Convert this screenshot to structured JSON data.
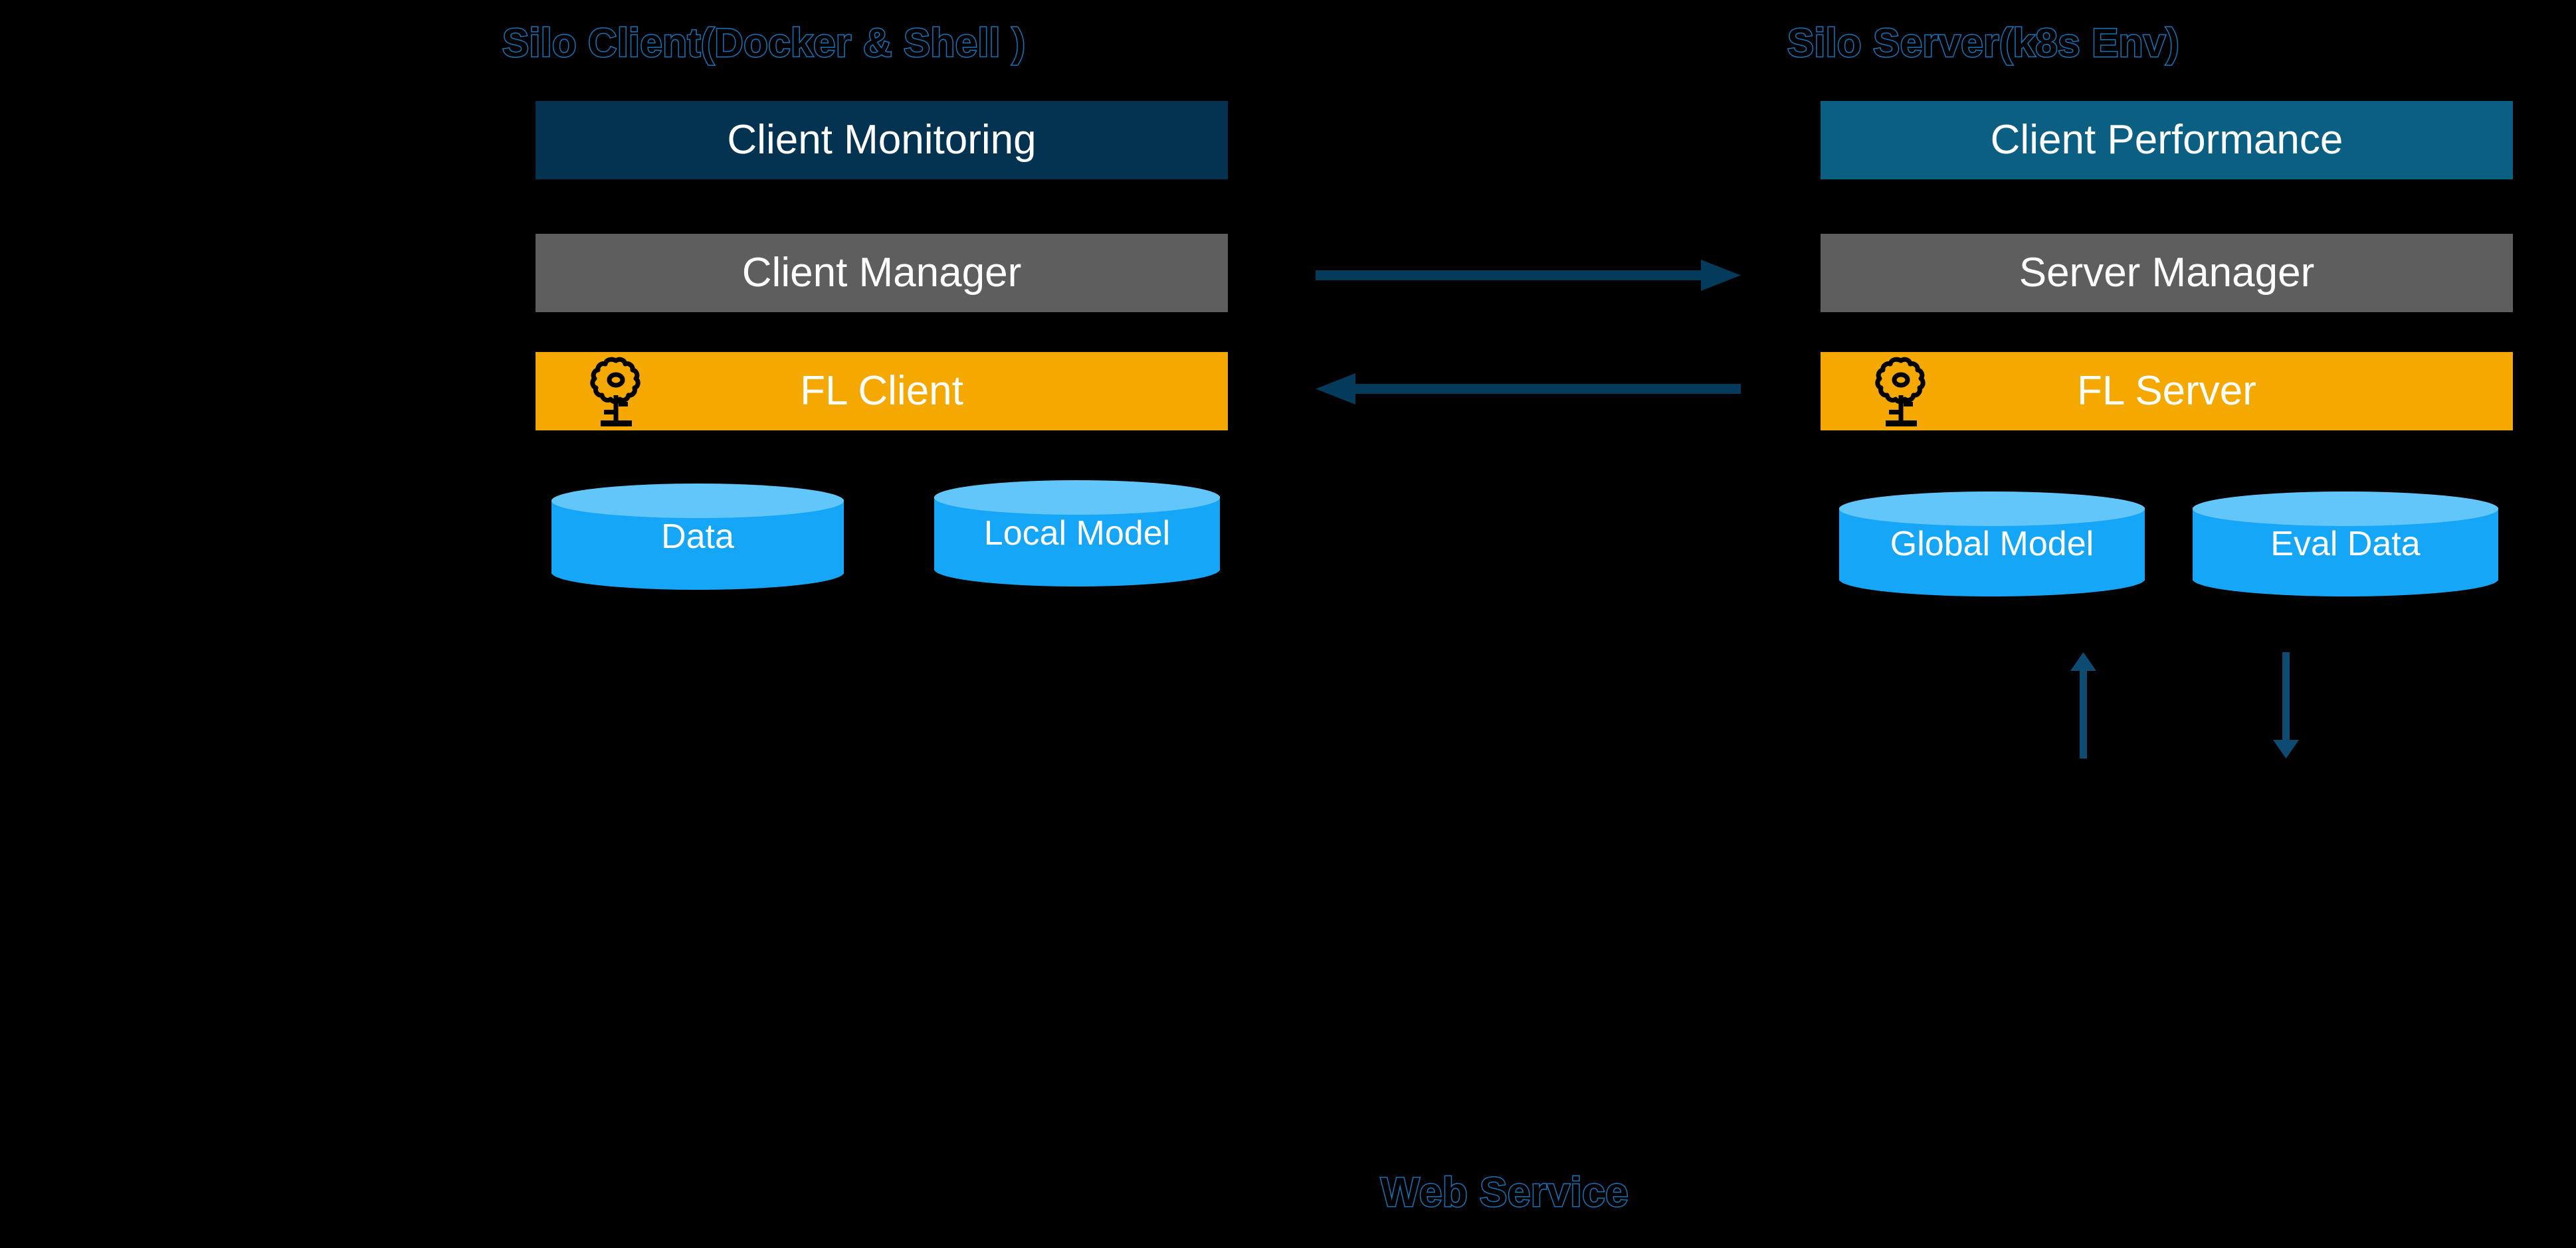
{
  "diagram": {
    "background_color": "#000000",
    "headings": [
      {
        "id": "client-col-title",
        "text": "Silo Client(Docker & Shell )"
      },
      {
        "id": "server-col-title",
        "text": "Silo Server(k8s Env)"
      },
      {
        "id": "web-service-title",
        "text": "Web Service"
      }
    ],
    "client_column": {
      "title": "Silo Client(Docker & Shell )",
      "blocks": [
        {
          "label": "Client Monitoring",
          "color": "#043351",
          "icon": null
        },
        {
          "label": "Client Manager",
          "color": "#5e5e5e",
          "icon": null
        },
        {
          "label": "FL Client",
          "color": "#f5a800",
          "icon": "flower-icon"
        }
      ],
      "stores": [
        {
          "label": "Data",
          "body_color": "#16a6f7",
          "top_color": "#62c6fb"
        },
        {
          "label": "Local Model",
          "body_color": "#16a6f7",
          "top_color": "#62c6fb"
        }
      ]
    },
    "server_column": {
      "title": "Silo Server(k8s Env)",
      "blocks": [
        {
          "label": "Client Performance",
          "color": "#0a5f82",
          "icon": null
        },
        {
          "label": "Server Manager",
          "color": "#5e5e5e",
          "icon": null
        },
        {
          "label": "FL Server",
          "color": "#f5a800",
          "icon": "flower-icon"
        }
      ],
      "stores": [
        {
          "label": "Global Model",
          "body_color": "#16a6f7",
          "top_color": "#62c6fb"
        },
        {
          "label": "Eval Data",
          "body_color": "#16a6f7",
          "top_color": "#62c6fb"
        }
      ]
    },
    "connectors": [
      {
        "id": "manager-to-server",
        "direction": "right",
        "color": "#043b5c"
      },
      {
        "id": "server-to-client",
        "direction": "left",
        "color": "#043b5c"
      },
      {
        "id": "global-model-up",
        "direction": "up",
        "color": "#0d4b72"
      },
      {
        "id": "eval-data-down",
        "direction": "down",
        "color": "#0d4b72"
      }
    ],
    "colors": {
      "heading_outline": "#1574b8",
      "block_navy": "#043351",
      "block_teal": "#0a5f82",
      "block_gray": "#5e5e5e",
      "block_orange": "#f5a800",
      "cylinder_body": "#16a6f7",
      "cylinder_top": "#62c6fb",
      "arrow_navy": "#043b5c",
      "text_white": "#ffffff"
    }
  }
}
